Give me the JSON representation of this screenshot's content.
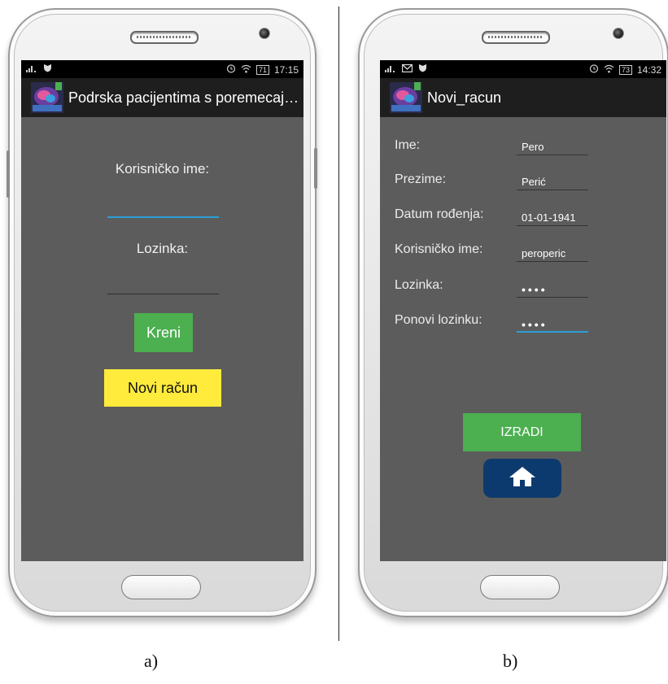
{
  "left_screen": {
    "status": {
      "time": "17:15",
      "battery": "71"
    },
    "title": "Podrska pacijentima s poremecaje...",
    "username_label": "Korisničko ime:",
    "username_value": "",
    "password_label": "Lozinka:",
    "password_value": "",
    "go_button": "Kreni",
    "new_account_button": "Novi račun"
  },
  "right_screen": {
    "status": {
      "time": "14:32",
      "battery": "73"
    },
    "title": "Novi_racun",
    "fields": [
      {
        "label": "Ime:",
        "value": "Pero"
      },
      {
        "label": "Prezime:",
        "value": "Perić"
      },
      {
        "label": "Datum rođenja:",
        "value": "01-01-1941"
      },
      {
        "label": "Korisničko ime:",
        "value": "peroperic"
      },
      {
        "label": "Lozinka:",
        "value": "••••"
      },
      {
        "label": "Ponovi lozinku:",
        "value": "••••"
      }
    ],
    "create_button": "IZRADI"
  },
  "captions": {
    "a": "a)",
    "b": "b)"
  },
  "icons": {
    "signal": "signal-icon",
    "shield": "shield-icon",
    "mail": "mail-icon",
    "alarm": "alarm-icon",
    "wifi": "wifi-icon",
    "home": "home-icon",
    "app": "brain-app-icon"
  },
  "colors": {
    "screen_bg": "#5c5c5c",
    "action_bar": "#1e1e1e",
    "green": "#4caf50",
    "yellow": "#ffeb3b",
    "focus_underline": "#2a9fd6",
    "home_button": "#0d3a6e"
  }
}
